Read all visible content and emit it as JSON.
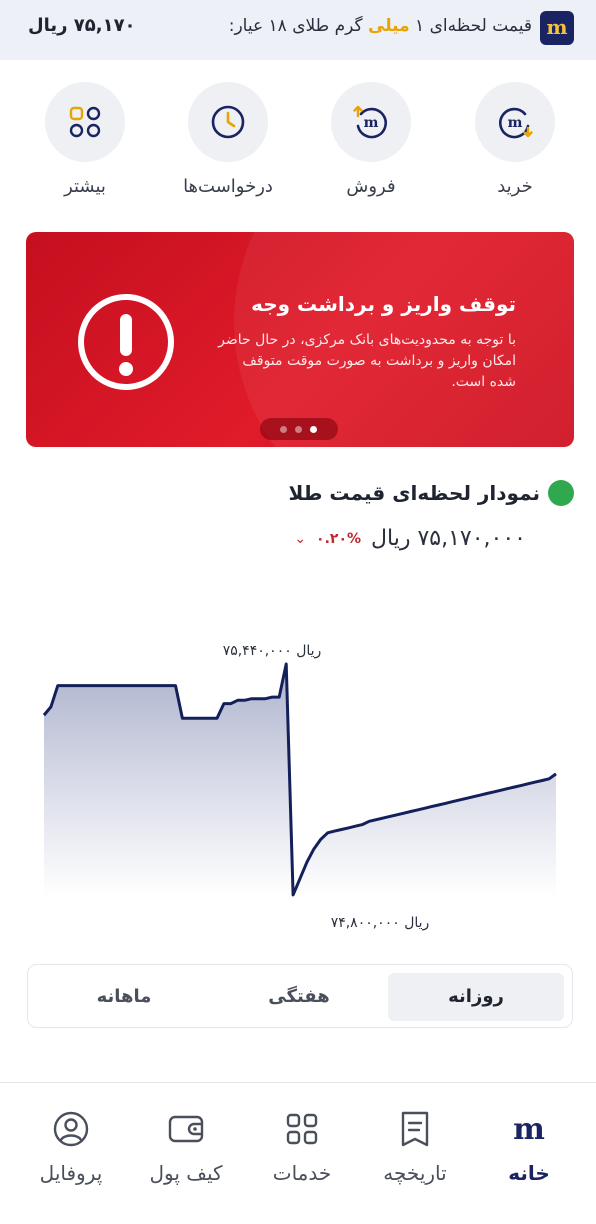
{
  "ticker": {
    "logo_letter": "m",
    "text_before": "قیمت لحظه‌ای ۱",
    "text_highlight": "میلی",
    "text_after": "گرم طلای ۱۸ عیار:",
    "price": "۷۵,۱۷۰ ریال"
  },
  "actions": [
    {
      "label": "خرید",
      "icon": "buy-icon"
    },
    {
      "label": "فروش",
      "icon": "sell-icon"
    },
    {
      "label": "درخواست‌ها",
      "icon": "clock-icon"
    },
    {
      "label": "بیشتر",
      "icon": "more-grid-icon"
    }
  ],
  "banner": {
    "title": "توقف واریز و برداشت وجه",
    "body": "با توجه به محدودیت‌های بانک مرکزی، در حال حاضر امکان واریز و برداشت به صورت موقت متوقف شده است.",
    "slides": 3,
    "active_slide": 1,
    "icon": "alert-icon",
    "color": "#d7121f"
  },
  "chart_section": {
    "title": "نمودار لحظه‌ای قیمت طلا",
    "price": "۷۵,۱۷۰,۰۰۰ ریال",
    "change": "۰.۲۰%",
    "change_direction": "down",
    "status_color": "#2fa84f"
  },
  "chart_data": {
    "type": "area",
    "title": "",
    "xlabel": "",
    "ylabel": "",
    "grid": false,
    "ylim": [
      74760000,
      75500000
    ],
    "annotations": {
      "max_label": "۷۵,۴۴۰,۰۰۰ ریال",
      "min_label": "۷۴,۸۰۰,۰۰۰ ریال"
    },
    "series": [
      {
        "values": [
          75350000,
          75375000,
          75440000,
          75440000,
          75440000,
          75440000,
          75440000,
          75440000,
          75440000,
          75440000,
          75440000,
          75440000,
          75440000,
          75440000,
          75440000,
          75440000,
          75440000,
          75440000,
          75440000,
          75440000,
          75340000,
          75340000,
          75340000,
          75340000,
          75340000,
          75340000,
          75385000,
          75385000,
          75395000,
          75395000,
          75400000,
          75400000,
          75400000,
          75405000,
          75405000,
          75800000,
          74800000,
          74850000,
          74900000,
          74940000,
          74970000,
          74990000,
          74995000,
          75000000,
          75005000,
          75010000,
          75015000,
          75025000,
          75030000,
          75035000,
          75040000,
          75045000,
          75050000,
          75055000,
          75060000,
          75065000,
          75070000,
          75075000,
          75080000,
          75085000,
          75090000,
          75095000,
          75100000,
          75105000,
          75110000,
          75115000,
          75120000,
          75125000,
          75130000,
          75135000,
          75140000,
          75145000,
          75150000,
          75155000,
          75170000
        ]
      }
    ]
  },
  "tabs": [
    {
      "label": "روزانه",
      "active": true
    },
    {
      "label": "هفتگی",
      "active": false
    },
    {
      "label": "ماهانه",
      "active": false
    }
  ],
  "nav": [
    {
      "label": "خانه",
      "icon": "home-logo-icon",
      "active": true
    },
    {
      "label": "تاریخچه",
      "icon": "history-icon",
      "active": false
    },
    {
      "label": "خدمات",
      "icon": "services-icon",
      "active": false
    },
    {
      "label": "کیف پول",
      "icon": "wallet-icon",
      "active": false
    },
    {
      "label": "پروفایل",
      "icon": "profile-icon",
      "active": false
    }
  ]
}
